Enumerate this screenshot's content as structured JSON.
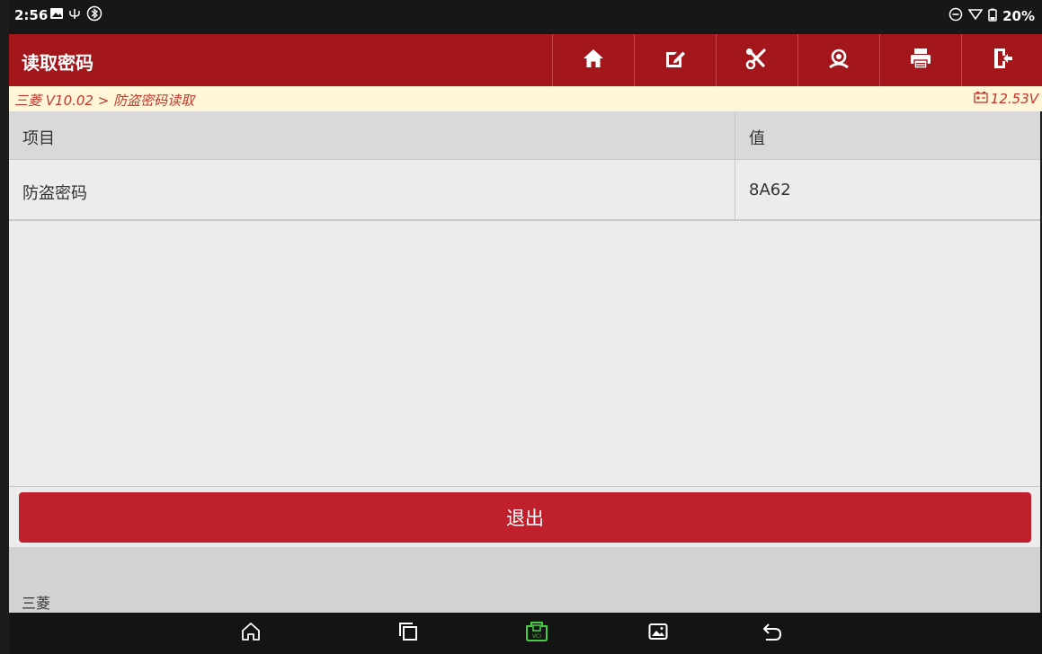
{
  "status_bar": {
    "time": "2:56",
    "battery": "20%",
    "icons": [
      "gallery-icon",
      "usb-icon",
      "bluetooth-icon",
      "dnd-icon",
      "wifi-icon",
      "battery-icon"
    ]
  },
  "header": {
    "title": "读取密码",
    "toolbar_icons": [
      "home-icon",
      "edit-icon",
      "tools-icon",
      "support-icon",
      "print-icon",
      "exit-icon"
    ]
  },
  "breadcrumb": {
    "path": "三菱 V10.02 > 防盗密码读取",
    "voltage": "12.53V"
  },
  "table": {
    "columns": [
      "项目",
      "值"
    ],
    "rows": [
      {
        "item": "防盗密码",
        "value": "8A62"
      }
    ]
  },
  "actions": {
    "exit_label": "退出"
  },
  "footer": {
    "brand": "三菱"
  },
  "nav_bar": {
    "icons": [
      "home-icon",
      "recent-apps-icon",
      "vci-icon",
      "screenshot-icon",
      "back-icon"
    ]
  },
  "colors": {
    "header_bg": "#a3161c",
    "exit_button": "#c0202c",
    "breadcrumb_text": "#c0392b",
    "breadcrumb_bg": "#fff6d9",
    "vci_accent": "#3fcf3f"
  }
}
